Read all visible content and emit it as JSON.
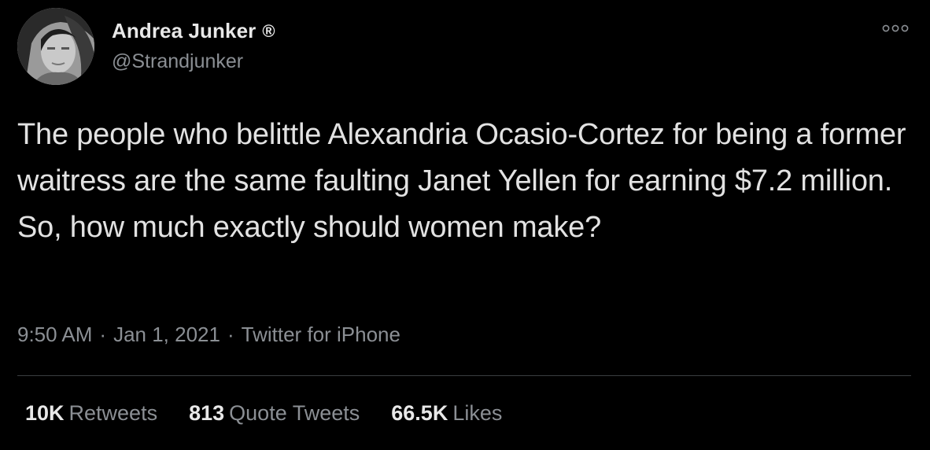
{
  "author": {
    "name": "Andrea Junker",
    "verified_mark": "®",
    "handle": "@Strandjunker"
  },
  "more_icon": "ellipsis-icon",
  "tweet": {
    "text": "The people who belittle Alexandria Ocasio-Cortez for being a former waitress are the same faulting Janet Yellen for earning $7.2 million. So, how much exactly should women make?"
  },
  "meta": {
    "time": "9:50 AM",
    "separator": "·",
    "date": "Jan 1, 2021",
    "source": "Twitter for iPhone"
  },
  "stats": {
    "retweets": {
      "count": "10K",
      "label": "Retweets"
    },
    "quote_tweets": {
      "count": "813",
      "label": "Quote Tweets"
    },
    "likes": {
      "count": "66.5K",
      "label": "Likes"
    }
  },
  "colors": {
    "background": "#000000",
    "primary_text": "#e2e2e2",
    "secondary_text": "#8b8f94",
    "divider": "#3a3d40"
  }
}
